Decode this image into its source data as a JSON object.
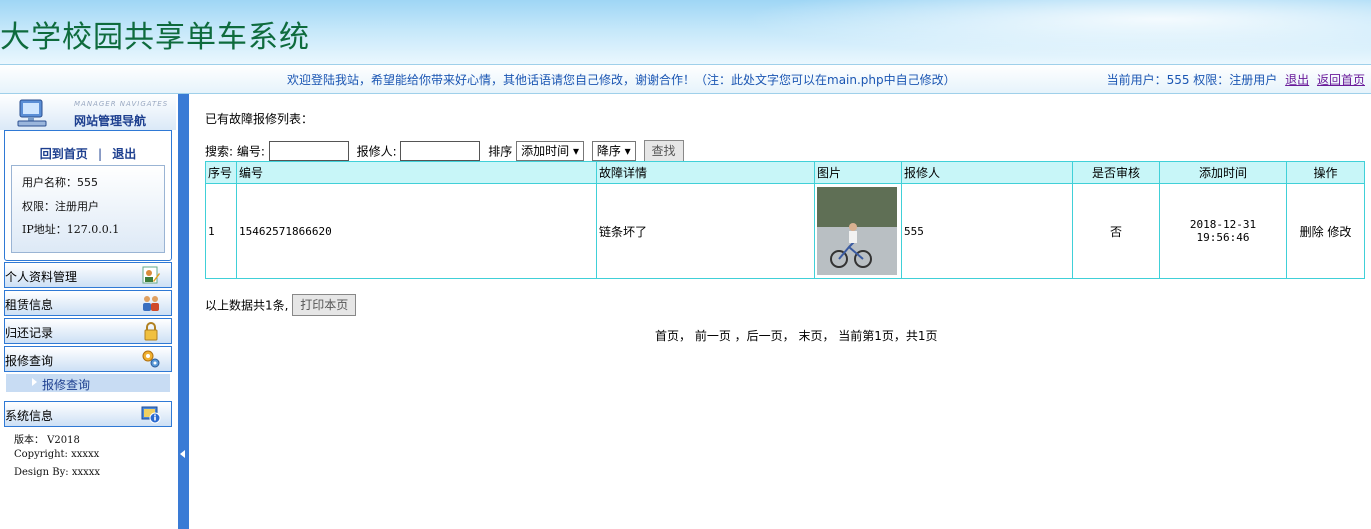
{
  "header": {
    "title": "大学校园共享单车系统",
    "welcome": "欢迎登陆我站，希望能给你带来好心情，其他话语请您自己修改，谢谢合作！（注：此处文字您可以在main.php中自己修改）",
    "user_prefix": "当前用户：555 权限：注册用户",
    "logout": "退出",
    "back_home": "返回首页"
  },
  "sidebar": {
    "caption": "MANAGER NAVIGATES",
    "title": "网站管理导航",
    "home_link": "回到首页",
    "separator": "|",
    "exit_link": "退出",
    "username_line": "用户名称：555",
    "role_line": "权限：注册用户",
    "ip_line": "IP地址：127.0.0.1",
    "menu": [
      {
        "label": "个人资料管理",
        "icon": "user-edit-icon"
      },
      {
        "label": "租赁信息",
        "icon": "users-icon"
      },
      {
        "label": "归还记录",
        "icon": "lock-icon"
      },
      {
        "label": "报修查询",
        "icon": "gears-icon"
      }
    ],
    "sub_item": "报修查询",
    "system_menu": {
      "label": "系统信息",
      "icon": "info-icon"
    },
    "version_line": "版本： V2018",
    "copyright_line": "Copyright: xxxxx",
    "design_line": "Design By:  xxxxx"
  },
  "main": {
    "list_title": "已有故障报修列表：",
    "search": {
      "label": "搜索:",
      "code_label": "编号:",
      "reporter_label": "报修人:",
      "sort_label": "排序",
      "sort_field": "添加时间",
      "sort_order": "降序",
      "find_button": "查找"
    },
    "table": {
      "headers": [
        "序号",
        "编号",
        "故障详情",
        "图片",
        "报修人",
        "是否审核",
        "添加时间",
        "操作"
      ],
      "rows": [
        {
          "index": "1",
          "code": "15462571866620",
          "detail": "链条坏了",
          "reporter": "555",
          "reviewed": "否",
          "time": "2018-12-31 19:56:46",
          "delete": "删除",
          "edit": "修改"
        }
      ]
    },
    "summary": "以上数据共1条,",
    "print_button": "打印本页",
    "pager": "首页，  前一页  ，后一页，  末页，  当前第1页，共1页"
  },
  "colors": {
    "title_green": "#0e6b3d",
    "link_blue": "#1b56b3",
    "border_cyan": "#40d0d8",
    "sidebar_blue": "#2f79d5"
  }
}
